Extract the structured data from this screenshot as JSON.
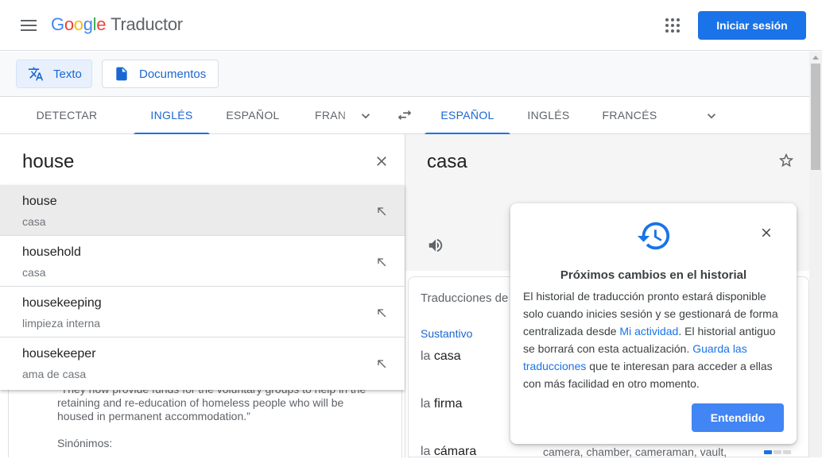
{
  "header": {
    "logo_letters": [
      "G",
      "o",
      "o",
      "g",
      "l",
      "e"
    ],
    "app_name": "Traductor",
    "signin_label": "Iniciar sesión"
  },
  "modes": {
    "text_label": "Texto",
    "documents_label": "Documentos"
  },
  "source_langs": [
    "DETECTAR IDIOMA",
    "INGLÉS",
    "ESPAÑOL",
    "FRANCÉS"
  ],
  "source_active_index": 1,
  "target_langs": [
    "ESPAÑOL",
    "INGLÉS",
    "FRANCÉS"
  ],
  "target_active_index": 0,
  "source": {
    "text": "house"
  },
  "target": {
    "text": "casa"
  },
  "suggestions": [
    {
      "word": "house",
      "translation": "casa"
    },
    {
      "word": "household",
      "translation": "casa"
    },
    {
      "word": "housekeeping",
      "translation": "limpieza interna"
    },
    {
      "word": "housekeeper",
      "translation": "ama de casa"
    }
  ],
  "example": {
    "text": "“They now provide funds for the voluntary groups to help in the retaining and re-education of homeless people who will be housed in permanent accommodation.”",
    "synonyms_label": "Sinónimos:"
  },
  "dictionary": {
    "title": "Traducciones de house",
    "pos": "Sustantivo",
    "entries": [
      {
        "article": "la",
        "word": "casa"
      },
      {
        "article": "la",
        "word": "firma"
      },
      {
        "article": "la",
        "word": "cámara",
        "reverse": "camera, chamber, cameraman, vault,"
      }
    ]
  },
  "popup": {
    "title": "Próximos cambios en el historial",
    "body_1": "El historial de traducción pronto estará disponible solo cuando inicies sesión y se gestionará de forma centralizada desde ",
    "link_1": "Mi actividad",
    "body_2": ". El historial antiguo se borrará con esta actualización. ",
    "link_2": "Guarda las traducciones",
    "body_3": " que te interesan para acceder a ellas con más facilidad en otro momento.",
    "button_label": "Entendido"
  },
  "colors": {
    "accent": "#1a73e8",
    "active_tab": "#1967d2",
    "button_blue": "#4285f4"
  }
}
